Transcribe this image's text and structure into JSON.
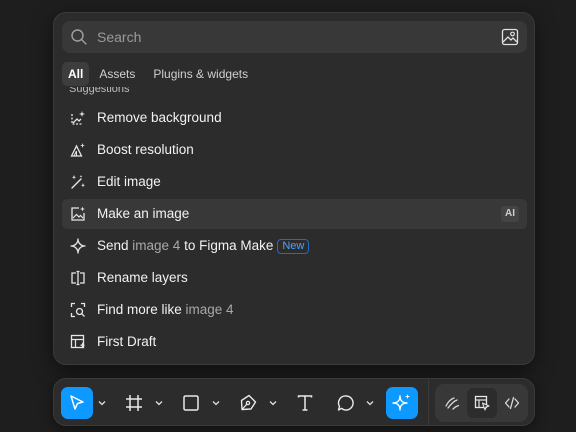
{
  "search": {
    "placeholder": "Search",
    "value": ""
  },
  "tabs": [
    {
      "label": "All",
      "active": true
    },
    {
      "label": "Assets",
      "active": false
    },
    {
      "label": "Plugins & widgets",
      "active": false
    }
  ],
  "section_label": "Suggestions",
  "items": [
    {
      "icon": "remove-background-icon",
      "label": "Remove background"
    },
    {
      "icon": "boost-resolution-icon",
      "label": "Boost resolution"
    },
    {
      "icon": "edit-image-icon",
      "label": "Edit image"
    },
    {
      "icon": "make-image-icon",
      "label": "Make an image",
      "badge": "AI",
      "highlighted": true
    },
    {
      "icon": "figma-make-icon",
      "label_parts": [
        "Send ",
        "image 4",
        " to Figma Make"
      ],
      "badge": "New"
    },
    {
      "icon": "rename-layers-icon",
      "label": "Rename layers"
    },
    {
      "icon": "find-more-icon",
      "label_parts": [
        "Find more like ",
        "image 4"
      ]
    },
    {
      "icon": "first-draft-icon",
      "label": "First Draft"
    }
  ],
  "toolbar": {
    "tools": [
      {
        "icon": "move-tool-icon",
        "active": true
      },
      {
        "icon": "frame-tool-icon"
      },
      {
        "icon": "rectangle-tool-icon"
      },
      {
        "icon": "pen-tool-icon"
      },
      {
        "icon": "text-tool-icon"
      },
      {
        "icon": "comment-tool-icon"
      },
      {
        "icon": "ai-actions-icon",
        "active": true
      }
    ],
    "modes": [
      {
        "icon": "draw-mode-icon"
      },
      {
        "icon": "design-mode-icon",
        "selected": true
      },
      {
        "icon": "dev-mode-icon"
      }
    ]
  },
  "colors": {
    "accent": "#0d99ff",
    "panel": "#2c2c2c",
    "new_badge": "#4ea1ff"
  }
}
